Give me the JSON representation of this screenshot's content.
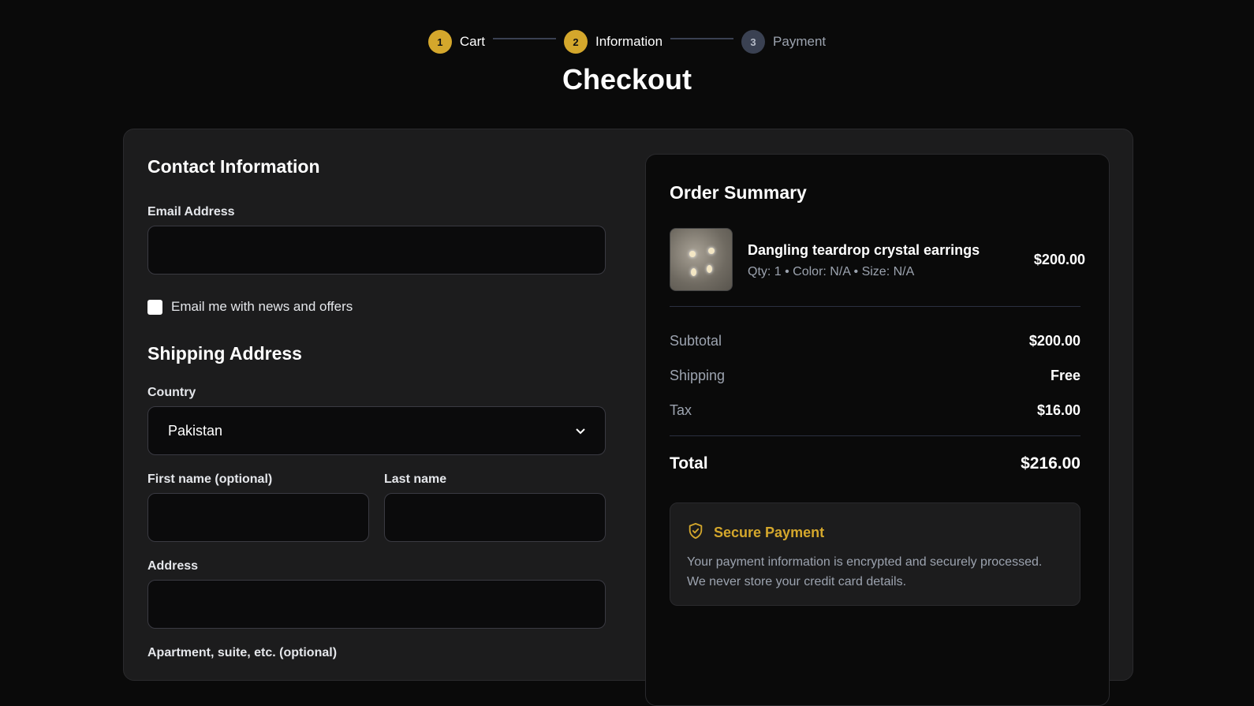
{
  "steps": [
    {
      "num": "1",
      "label": "Cart",
      "state": "done"
    },
    {
      "num": "2",
      "label": "Information",
      "state": "active"
    },
    {
      "num": "3",
      "label": "Payment",
      "state": "upcoming"
    }
  ],
  "page_title": "Checkout",
  "contact": {
    "title": "Contact Information",
    "email_label": "Email Address",
    "email_value": "",
    "newsletter_label": "Email me with news and offers",
    "newsletter_checked": false
  },
  "shipping": {
    "title": "Shipping Address",
    "country_label": "Country",
    "country_value": "Pakistan",
    "first_name_label": "First name (optional)",
    "first_name_value": "",
    "last_name_label": "Last name",
    "last_name_value": "",
    "address_label": "Address",
    "address_value": "",
    "apartment_label": "Apartment, suite, etc. (optional)"
  },
  "summary": {
    "title": "Order Summary",
    "item": {
      "name": "Dangling teardrop crystal earrings",
      "meta": "Qty: 1 • Color: N/A • Size: N/A",
      "price": "$200.00"
    },
    "subtotal_label": "Subtotal",
    "subtotal_value": "$200.00",
    "shipping_label": "Shipping",
    "shipping_value": "Free",
    "tax_label": "Tax",
    "tax_value": "$16.00",
    "total_label": "Total",
    "total_value": "$216.00"
  },
  "secure": {
    "title": "Secure Payment",
    "text": "Your payment information is encrypted and securely processed. We never store your credit card details.",
    "icon": "shield-check-icon"
  },
  "colors": {
    "accent": "#d4a72c",
    "background": "#0a0a0a",
    "card": "#1c1c1d"
  }
}
